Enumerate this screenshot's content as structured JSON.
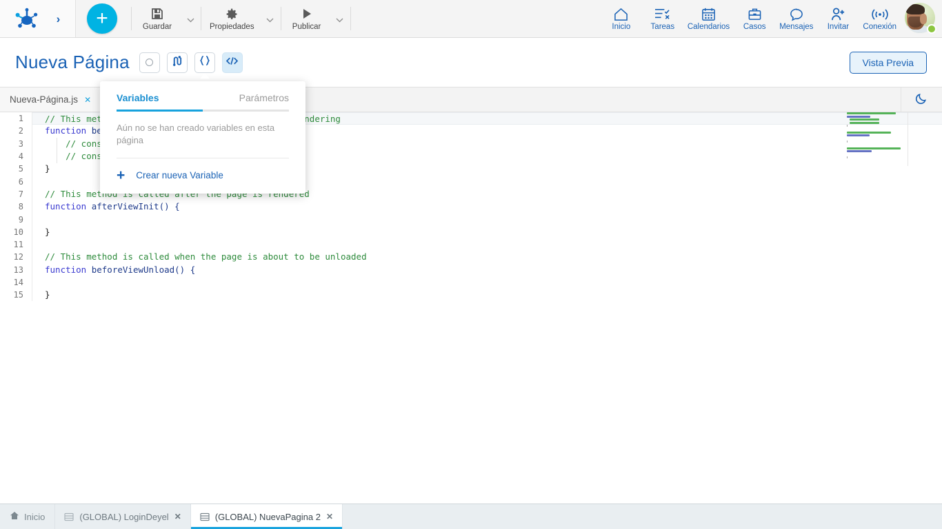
{
  "topbar": {
    "logo_name": "deyel-logo",
    "expand_label": "›",
    "add_label": "+",
    "tools": [
      {
        "label": "Guardar",
        "icon": "save-icon",
        "caret": true
      },
      {
        "label": "Propiedades",
        "icon": "gear-icon",
        "caret": true
      },
      {
        "label": "Publicar",
        "icon": "play-icon",
        "caret": true
      }
    ],
    "nav": [
      {
        "label": "Inicio",
        "icon": "home-icon"
      },
      {
        "label": "Tareas",
        "icon": "tasks-icon"
      },
      {
        "label": "Calendarios",
        "icon": "calendar-icon"
      },
      {
        "label": "Casos",
        "icon": "briefcase-icon"
      },
      {
        "label": "Mensajes",
        "icon": "message-icon"
      },
      {
        "label": "Invitar",
        "icon": "invite-user-icon"
      },
      {
        "label": "Conexión",
        "icon": "connection-icon"
      }
    ],
    "avatar_name": "user-avatar",
    "status": "online"
  },
  "pageheader": {
    "title": "Nueva Página",
    "buttons": [
      {
        "name": "state-circle-button",
        "icon": "circle-icon",
        "active": false
      },
      {
        "name": "flow-button",
        "icon": "flow-icon",
        "active": false
      },
      {
        "name": "variables-button",
        "icon": "braces-icon",
        "active": false
      },
      {
        "name": "code-button",
        "icon": "code-icon",
        "active": true
      }
    ],
    "preview_label": "Vista Previa"
  },
  "popup": {
    "tabs": [
      {
        "label": "Variables",
        "active": true
      },
      {
        "label": "Parámetros",
        "active": false
      }
    ],
    "empty_text": "Aún no se han creado variables en esta página",
    "create_label": "Crear nueva Variable",
    "plus": "+"
  },
  "editor": {
    "tab_label": "Nueva-Página.js",
    "tab_close": "✕",
    "theme_toggle": "moon-icon",
    "lines": [
      {
        "n": "1",
        "active": true,
        "segments": [
          {
            "t": "// This method is called before the page do any rendering",
            "c": "c-com"
          }
        ]
      },
      {
        "n": "2",
        "active": false,
        "segments": [
          {
            "t": "function ",
            "c": "c-kw"
          },
          {
            "t": "beforeViewInit() {",
            "c": "c-fn"
          }
        ]
      },
      {
        "n": "3",
        "active": false,
        "segments": [
          {
            "t": "    // console.log(getVariableValue();",
            "c": "c-com"
          }
        ]
      },
      {
        "n": "4",
        "active": false,
        "segments": [
          {
            "t": "    // console.log(setVariableValue();",
            "c": "c-com"
          }
        ]
      },
      {
        "n": "5",
        "active": false,
        "segments": [
          {
            "t": "}",
            "c": "c-pl"
          }
        ]
      },
      {
        "n": "6",
        "active": false,
        "segments": [
          {
            "t": "",
            "c": "c-pl"
          }
        ]
      },
      {
        "n": "7",
        "active": false,
        "segments": [
          {
            "t": "// This method is called after the page is rendered",
            "c": "c-com"
          }
        ]
      },
      {
        "n": "8",
        "active": false,
        "segments": [
          {
            "t": "function ",
            "c": "c-kw"
          },
          {
            "t": "afterViewInit() {",
            "c": "c-fn"
          }
        ]
      },
      {
        "n": "9",
        "active": false,
        "segments": [
          {
            "t": "",
            "c": "c-pl"
          }
        ]
      },
      {
        "n": "10",
        "active": false,
        "segments": [
          {
            "t": "}",
            "c": "c-pl"
          }
        ]
      },
      {
        "n": "11",
        "active": false,
        "segments": [
          {
            "t": "",
            "c": "c-pl"
          }
        ]
      },
      {
        "n": "12",
        "active": false,
        "segments": [
          {
            "t": "// This method is called when the page is about to be unloaded",
            "c": "c-com"
          }
        ]
      },
      {
        "n": "13",
        "active": false,
        "segments": [
          {
            "t": "function ",
            "c": "c-kw"
          },
          {
            "t": "beforeViewUnload() {",
            "c": "c-fn"
          }
        ]
      },
      {
        "n": "14",
        "active": false,
        "segments": [
          {
            "t": "",
            "c": "c-pl"
          }
        ]
      },
      {
        "n": "15",
        "active": false,
        "segments": [
          {
            "t": "}",
            "c": "c-pl"
          }
        ]
      }
    ]
  },
  "taskbar": {
    "home_label": "Inicio",
    "tasks": [
      {
        "label": "(GLOBAL) LoginDeyel",
        "active": false,
        "close": "✕"
      },
      {
        "label": "(GLOBAL) NuevaPagina 2",
        "active": true,
        "close": "✕"
      }
    ]
  },
  "colors": {
    "accent": "#17a2dd",
    "brand_blue": "#1a62b5",
    "comment_green": "#2e8b3c",
    "keyword_blue": "#3a3ad0",
    "online_green": "#8cc63f"
  }
}
